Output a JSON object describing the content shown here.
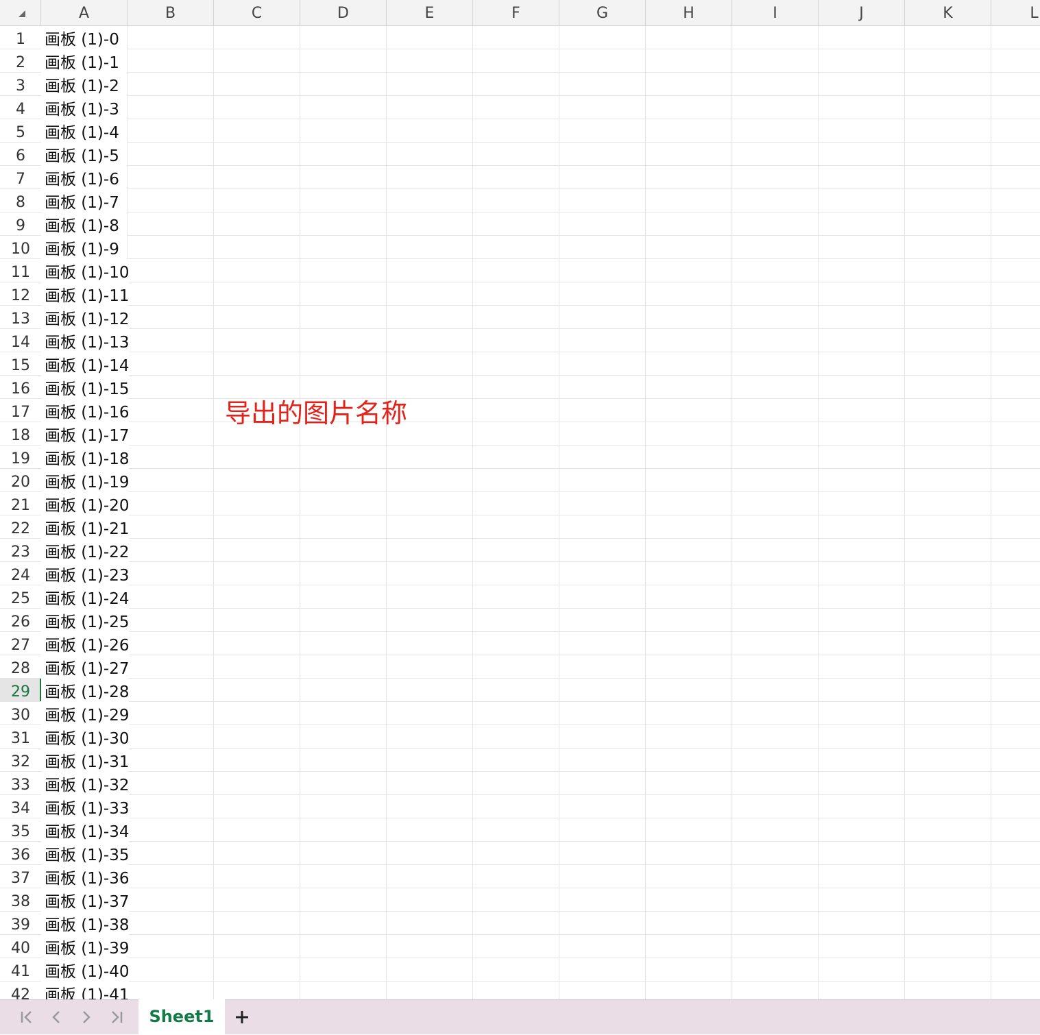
{
  "sheet": {
    "columns": [
      "A",
      "B",
      "C",
      "D",
      "E",
      "F",
      "G",
      "H",
      "I",
      "J",
      "K",
      "L"
    ],
    "rows": [
      {
        "num": "1",
        "a": "画板 (1)-0"
      },
      {
        "num": "2",
        "a": "画板 (1)-1"
      },
      {
        "num": "3",
        "a": "画板 (1)-2"
      },
      {
        "num": "4",
        "a": "画板 (1)-3"
      },
      {
        "num": "5",
        "a": "画板 (1)-4"
      },
      {
        "num": "6",
        "a": "画板 (1)-5"
      },
      {
        "num": "7",
        "a": "画板 (1)-6"
      },
      {
        "num": "8",
        "a": "画板 (1)-7"
      },
      {
        "num": "9",
        "a": "画板 (1)-8"
      },
      {
        "num": "10",
        "a": "画板 (1)-9"
      },
      {
        "num": "11",
        "a": "画板 (1)-10"
      },
      {
        "num": "12",
        "a": "画板 (1)-11"
      },
      {
        "num": "13",
        "a": "画板 (1)-12"
      },
      {
        "num": "14",
        "a": "画板 (1)-13"
      },
      {
        "num": "15",
        "a": "画板 (1)-14"
      },
      {
        "num": "16",
        "a": "画板 (1)-15"
      },
      {
        "num": "17",
        "a": "画板 (1)-16"
      },
      {
        "num": "18",
        "a": "画板 (1)-17"
      },
      {
        "num": "19",
        "a": "画板 (1)-18"
      },
      {
        "num": "20",
        "a": "画板 (1)-19"
      },
      {
        "num": "21",
        "a": "画板 (1)-20"
      },
      {
        "num": "22",
        "a": "画板 (1)-21"
      },
      {
        "num": "23",
        "a": "画板 (1)-22"
      },
      {
        "num": "24",
        "a": "画板 (1)-23"
      },
      {
        "num": "25",
        "a": "画板 (1)-24"
      },
      {
        "num": "26",
        "a": "画板 (1)-25"
      },
      {
        "num": "27",
        "a": "画板 (1)-26"
      },
      {
        "num": "28",
        "a": "画板 (1)-27"
      },
      {
        "num": "29",
        "a": "画板 (1)-28"
      },
      {
        "num": "30",
        "a": "画板 (1)-29"
      },
      {
        "num": "31",
        "a": "画板 (1)-30"
      },
      {
        "num": "32",
        "a": "画板 (1)-31"
      },
      {
        "num": "33",
        "a": "画板 (1)-32"
      },
      {
        "num": "34",
        "a": "画板 (1)-33"
      },
      {
        "num": "35",
        "a": "画板 (1)-34"
      },
      {
        "num": "36",
        "a": "画板 (1)-35"
      },
      {
        "num": "37",
        "a": "画板 (1)-36"
      },
      {
        "num": "38",
        "a": "画板 (1)-37"
      },
      {
        "num": "39",
        "a": "画板 (1)-38"
      },
      {
        "num": "40",
        "a": "画板 (1)-39"
      },
      {
        "num": "41",
        "a": "画板 (1)-40"
      },
      {
        "num": "42",
        "a": "画板 (1)-41"
      }
    ],
    "active_row": "29",
    "annotation": "导出的图片名称",
    "annotation_color": "#e2221b"
  },
  "tabs": {
    "sheets": [
      "Sheet1"
    ],
    "active_sheet": "Sheet1",
    "active_color": "#137a4a",
    "nav_icons": [
      "first-sheet-icon",
      "prev-sheet-icon",
      "next-sheet-icon",
      "last-sheet-icon"
    ],
    "add_icon": "plus-icon"
  }
}
